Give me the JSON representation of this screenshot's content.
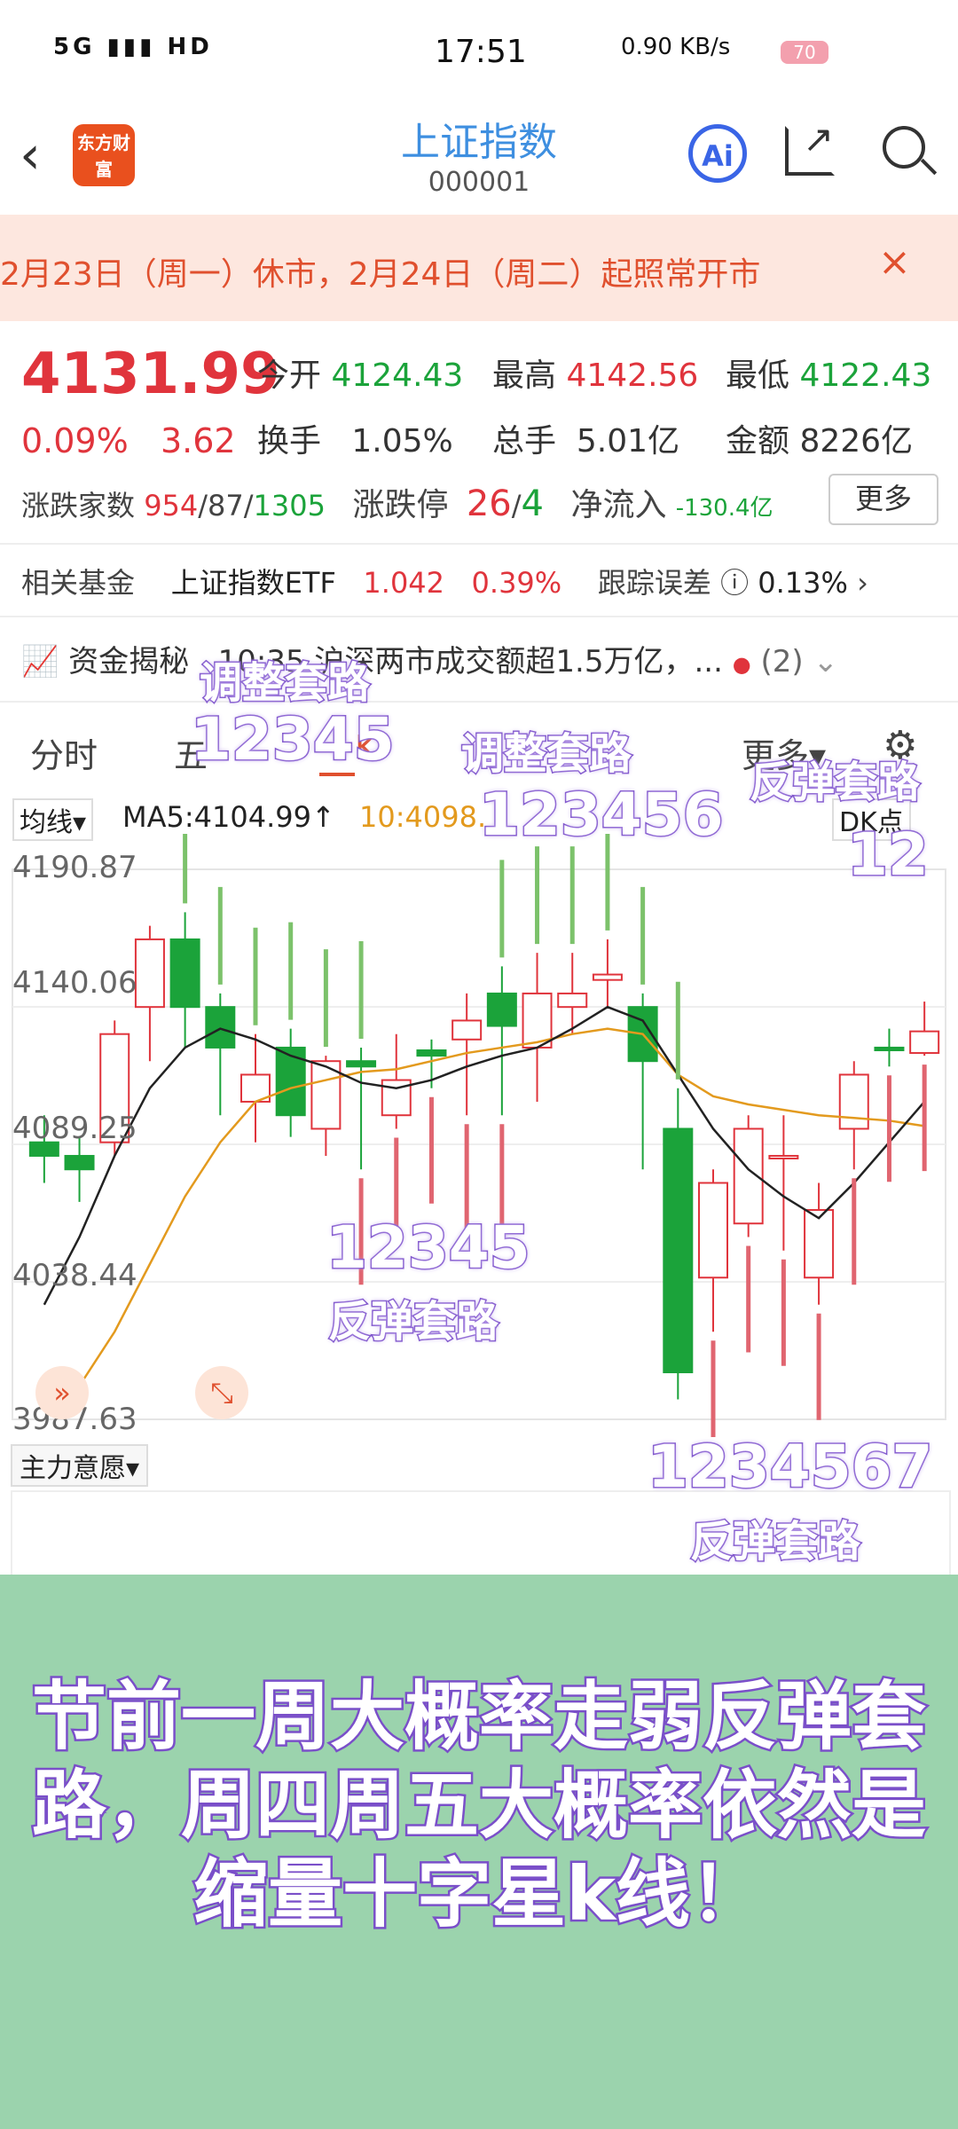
{
  "status_bar": {
    "network": "5G",
    "hd": "HD",
    "time": "17:51",
    "speed": "0.90 KB/s",
    "battery": "70"
  },
  "header": {
    "logo": "东方财富",
    "title": "上证指数",
    "code": "000001",
    "ai_label": "Ai"
  },
  "notice": {
    "text": "2月23日（周一）休市，2月24日（周二）起照常开市",
    "close": "×"
  },
  "quote": {
    "price": "4131.99",
    "change_pct": "0.09%",
    "change_abs": "3.62",
    "open_label": "今开",
    "open": "4124.43",
    "high_label": "最高",
    "high": "4142.56",
    "low_label": "最低",
    "low": "4122.43",
    "turnover_label": "换手",
    "turnover": "1.05%",
    "volume_label": "总手",
    "volume": "5.01亿",
    "amount_label": "金额",
    "amount": "8226亿",
    "updown_label": "涨跌家数",
    "up": "954",
    "flat": "87",
    "down": "1305",
    "limit_label": "涨跌停",
    "limit_up": "26",
    "limit_down": "4",
    "inflow_label": "净流入",
    "inflow": "-130.4亿",
    "more": "更多"
  },
  "fund": {
    "label": "相关基金",
    "name": "上证指数ETF",
    "price": "1.042",
    "pct": "0.39%",
    "err_label": "跟踪误差",
    "err": "0.13%"
  },
  "news": {
    "label": "资金揭秘",
    "text": "10:35 沪深两市成交额超1.5万亿，...",
    "count": "(2)"
  },
  "tabs": {
    "t1": "分时",
    "t2": "五",
    "t3": "K",
    "t4": "更多▾"
  },
  "chart_toolbar": {
    "ma_select": "均线▾",
    "ma5": "MA5:4104.99↑",
    "ma10": "10:4098.",
    "dk": "DK点"
  },
  "indicator": {
    "select": "主力意愿▾"
  },
  "chart_data": {
    "type": "candlestick",
    "y_ticks": [
      "4190.87",
      "4140.06",
      "4089.25",
      "4038.44",
      "3987.63"
    ],
    "ylim": [
      3987.63,
      4190.87
    ],
    "candles": [
      {
        "o": 4090,
        "c": 4085,
        "h": 4100,
        "l": 4075
      },
      {
        "o": 4085,
        "c": 4080,
        "h": 4092,
        "l": 4068
      },
      {
        "o": 4090,
        "c": 4130,
        "h": 4135,
        "l": 4085
      },
      {
        "o": 4140,
        "c": 4165,
        "h": 4170,
        "l": 4120
      },
      {
        "o": 4165,
        "c": 4140,
        "h": 4175,
        "l": 4125
      },
      {
        "o": 4140,
        "c": 4125,
        "h": 4145,
        "l": 4100
      },
      {
        "o": 4105,
        "c": 4115,
        "h": 4130,
        "l": 4090
      },
      {
        "o": 4125,
        "c": 4100,
        "h": 4132,
        "l": 4092
      },
      {
        "o": 4095,
        "c": 4120,
        "h": 4122,
        "l": 4085
      },
      {
        "o": 4120,
        "c": 4118,
        "h": 4125,
        "l": 4080
      },
      {
        "o": 4100,
        "c": 4113,
        "h": 4130,
        "l": 4095
      },
      {
        "o": 4124,
        "c": 4122,
        "h": 4128,
        "l": 4110
      },
      {
        "o": 4128,
        "c": 4135,
        "h": 4145,
        "l": 4100
      },
      {
        "o": 4145,
        "c": 4133,
        "h": 4155,
        "l": 4100
      },
      {
        "o": 4125,
        "c": 4145,
        "h": 4160,
        "l": 4105
      },
      {
        "o": 4140,
        "c": 4145,
        "h": 4160,
        "l": 4130
      },
      {
        "o": 4150,
        "c": 4152,
        "h": 4165,
        "l": 4140
      },
      {
        "o": 4140,
        "c": 4120,
        "h": 4145,
        "l": 4080
      },
      {
        "o": 4095,
        "c": 4005,
        "h": 4110,
        "l": 3995
      },
      {
        "o": 4040,
        "c": 4075,
        "h": 4080,
        "l": 4020
      },
      {
        "o": 4060,
        "c": 4095,
        "h": 4100,
        "l": 4055
      },
      {
        "o": 4085,
        "c": 4085,
        "h": 4100,
        "l": 4050
      },
      {
        "o": 4040,
        "c": 4065,
        "h": 4075,
        "l": 4030
      },
      {
        "o": 4095,
        "c": 4115,
        "h": 4120,
        "l": 4080
      },
      {
        "o": 4125,
        "c": 4124,
        "h": 4132,
        "l": 4118
      },
      {
        "o": 4123,
        "c": 4131,
        "h": 4142,
        "l": 4122
      }
    ],
    "ma5": [
      4030,
      4055,
      4085,
      4110,
      4125,
      4132,
      4128,
      4122,
      4118,
      4112,
      4110,
      4113,
      4118,
      4122,
      4125,
      4132,
      4140,
      4135,
      4115,
      4095,
      4080,
      4070,
      4062,
      4075,
      4090,
      4105
    ],
    "ma10": [
      3992,
      4000,
      4020,
      4045,
      4070,
      4090,
      4105,
      4110,
      4113,
      4116,
      4117,
      4120,
      4123,
      4125,
      4127,
      4130,
      4132,
      4130,
      4115,
      4107,
      4104,
      4102,
      4100,
      4099,
      4098,
      4096
    ]
  },
  "annotations": {
    "adj1_title": "调整套路",
    "adj1_nums": "12345",
    "adj2_title": "调整套路",
    "adj2_nums": "123456",
    "reb_top_title": "反弹套路",
    "reb_top_nums": "12",
    "reb1_nums": "12345",
    "reb1_title": "反弹套路",
    "reb2_nums": "1234567",
    "reb2_title": "反弹套路"
  },
  "caption": {
    "line1": "节前一周大概率走弱反弹套",
    "line2": "路，周四周五大概率依然是",
    "line3": "缩量十字星k线！"
  },
  "colors": {
    "up": "#e0343c",
    "down": "#1ba33a",
    "accent": "#3e8fe0",
    "overlay_stroke": "#7a4fc9"
  }
}
